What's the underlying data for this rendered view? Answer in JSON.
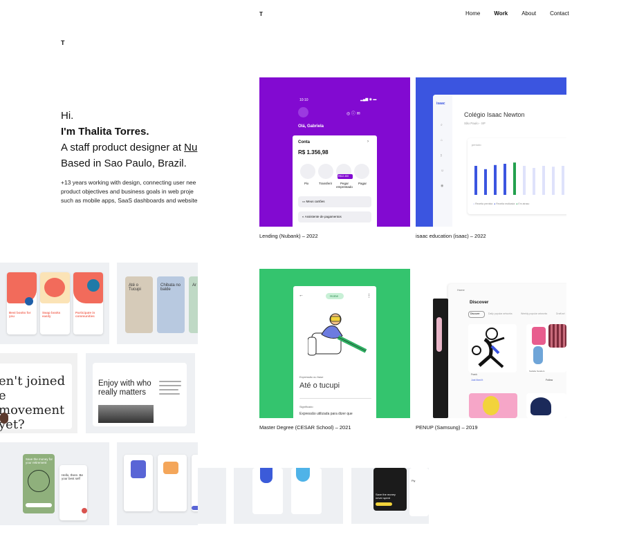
{
  "nav": {
    "logo": "T",
    "links": [
      "Home",
      "Work",
      "About",
      "Contact"
    ],
    "active": "Work"
  },
  "intro": {
    "logo": "T",
    "greeting": "Hi.",
    "name": "I'm Thalita Torres.",
    "role_prefix": "A staff product designer at ",
    "role_company": "Nu",
    "location": "Based in Sao Paulo, Brazil.",
    "desc_lines": [
      "+13 years working with design, connecting user nee",
      "product objectives and business goals in web proje",
      "such as mobile apps, SaaS dashboards and website"
    ]
  },
  "projects": [
    {
      "caption": "Lending (Nubank) – 2022",
      "bg": "#820ad1"
    },
    {
      "caption": "isaac education (isaac) – 2022",
      "bg": "#3b55e0"
    },
    {
      "caption": "Master Degree (CESAR School) – 2021",
      "bg": "#34c46e"
    },
    {
      "caption": "PENUP (Samsung) – 2019",
      "bg": "#ffffff"
    }
  ],
  "nubank": {
    "time": "10:10",
    "greeting": "Olá, Gabriela",
    "account_label": "Conta",
    "balance": "R$ 1.356,98",
    "actions": [
      "Pix",
      "Transferir",
      "Pegar emprestado",
      "Pagar"
    ],
    "badge": "R$12.450",
    "row1": "Meus cartões",
    "row2": "Assistente de pagamentos"
  },
  "isaac": {
    "logo": "isaac",
    "school": "Colégio Isaac Newton",
    "city": "São Paulo - SP",
    "chart_label": "período",
    "bars": [
      0.7,
      0.62,
      0.72,
      0.75,
      0.78,
      0.7,
      0.65,
      0.7,
      0.68,
      0.7
    ],
    "legend": [
      "Receita prevista",
      "Receita realizada",
      "Em atraso"
    ]
  },
  "cesar": {
    "badge": "Home",
    "small": "Expressão ou frase",
    "title": "Até o tucupi",
    "meaning_label": "Significado",
    "meaning": "Expressão utilizada para dizer que"
  },
  "penup": {
    "header": "Home",
    "title": "Discover",
    "tabs": [
      "Discover",
      "Daily popular artworks",
      "Weekly popular artworks",
      "Draft art"
    ],
    "follow": "Follow",
    "artist": "Sodabe Sanders",
    "artist2": "Frank",
    "follow2": "Just liked it"
  },
  "mosaic": {
    "card1": [
      "Best books for you",
      "Swap books easily",
      "Participate in communities"
    ],
    "card2": [
      "Até o Tucupi",
      "Chibata no balde",
      "Ar"
    ],
    "card3": "en't joined e movement yet?",
    "card4": "Enjoy with who really matters",
    "card5": "Save the money for your retirement",
    "card6": "Hello, there. Be your best self",
    "bottom1": "Save the money never spent",
    "bottom2": "Fly"
  }
}
